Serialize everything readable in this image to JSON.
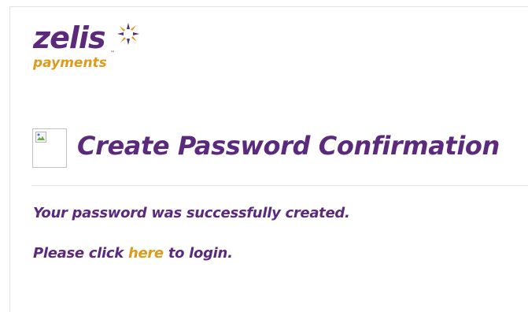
{
  "logo": {
    "brand": "zelis",
    "trademark": "™",
    "subtitle": "payments",
    "mark_icon": "zelis-starburst-icon",
    "colors": {
      "primary": "#5b2a7c",
      "accent": "#e09a1a"
    }
  },
  "header": {
    "image_icon": "broken-image-icon",
    "title": "Create Password Confirmation"
  },
  "message": {
    "line1": "Your password was successfully created.",
    "line2_prefix": "Please click ",
    "link_text": "here",
    "line2_suffix": " to login."
  },
  "colors": {
    "text": "#5b2a7c",
    "link": "#e09a1a",
    "divider": "#e6e6e6"
  }
}
